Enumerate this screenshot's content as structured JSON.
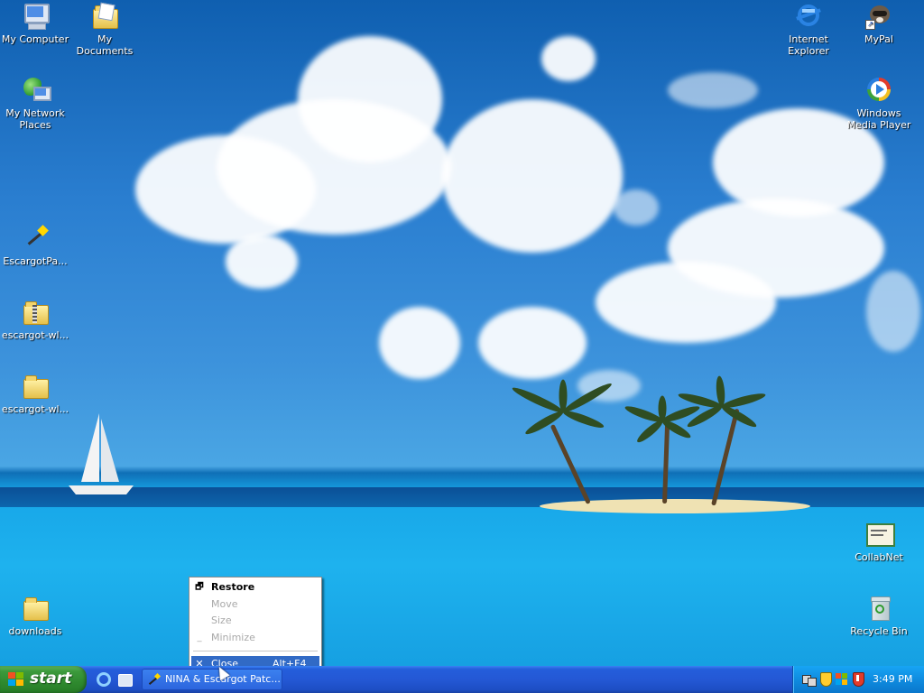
{
  "desktop": {
    "icons": {
      "my_computer": "My Computer",
      "my_documents": "My Documents",
      "network_places": "My Network Places",
      "internet_explorer": "Internet Explorer",
      "mypal": "MyPal",
      "wmp": "Windows Media Player",
      "escargot_patcher": "EscargotPa...",
      "escargot_zip": "escargot-wl...",
      "escargot_folder": "escargot-wl...",
      "collabnet": "CollabNet",
      "downloads": "downloads",
      "recycle_bin": "Recycle Bin"
    }
  },
  "context_menu": {
    "restore": "Restore",
    "move": "Move",
    "size": "Size",
    "minimize": "Minimize",
    "close": "Close",
    "close_shortcut": "Alt+F4"
  },
  "taskbar": {
    "start_label": "start",
    "task_label": "NINA & Escargot Patc...",
    "clock": "3:49 PM"
  },
  "colors": {
    "taskbar_blue": "#245edb",
    "start_green": "#3c9a3c",
    "tray_blue": "#0f8ce0",
    "menu_highlight": "#316ac5"
  }
}
